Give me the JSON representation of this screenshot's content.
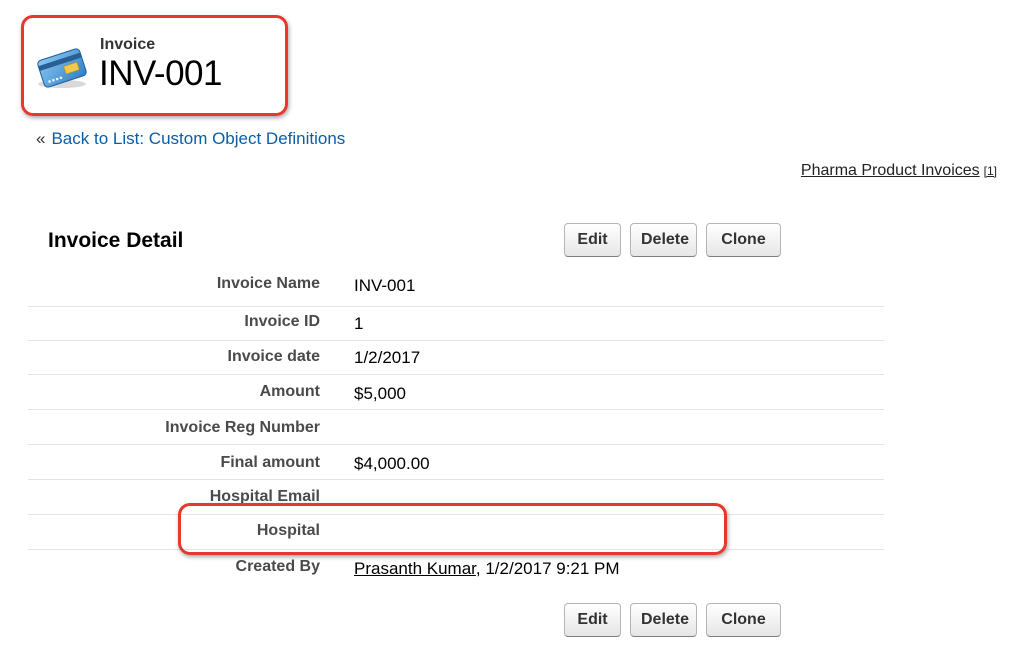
{
  "header": {
    "object_type": "Invoice",
    "record_name": "INV-001",
    "icon": "invoice-card-icon"
  },
  "back_link": {
    "prefix": "«",
    "label": "Back to List: Custom Object Definitions"
  },
  "related_list": {
    "label": "Pharma Product Invoices",
    "count": "[1]"
  },
  "detail": {
    "title": "Invoice Detail",
    "buttons": {
      "edit": "Edit",
      "delete": "Delete",
      "clone": "Clone"
    },
    "fields": [
      {
        "label": "Invoice Name",
        "value": "INV-001"
      },
      {
        "label": "Invoice ID",
        "value": "1"
      },
      {
        "label": "Invoice date",
        "value": "1/2/2017"
      },
      {
        "label": "Amount",
        "value": "$5,000"
      },
      {
        "label": "Invoice Reg Number",
        "value": ""
      },
      {
        "label": "Final amount",
        "value": "$4,000.00"
      },
      {
        "label": "Hospital Email",
        "value": ""
      },
      {
        "label": "Hospital",
        "value": ""
      },
      {
        "label": "Created By",
        "value_user": "Prasanth Kumar",
        "value_suffix": ", 1/2/2017 9:21 PM"
      }
    ]
  },
  "colors": {
    "highlight": "#e8372c",
    "link": "#0a5ea8"
  }
}
